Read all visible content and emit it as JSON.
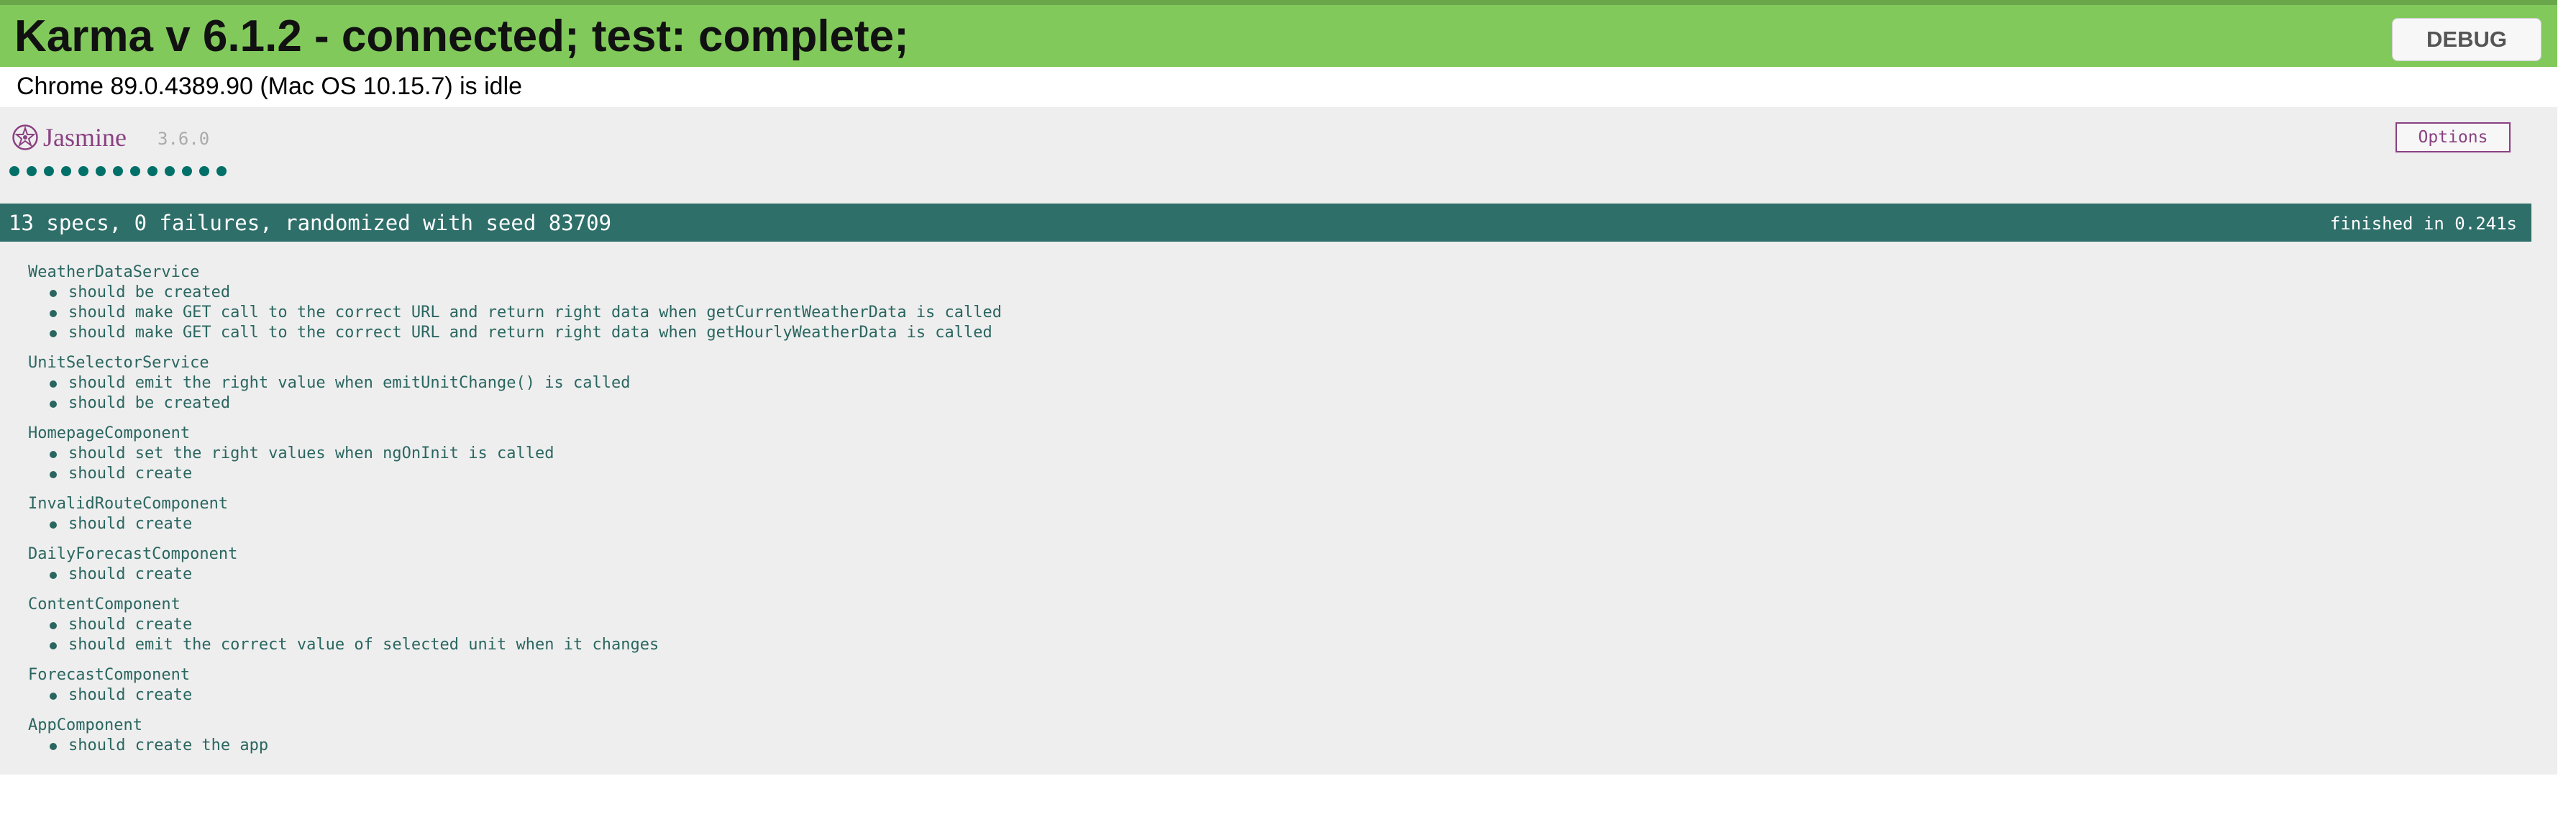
{
  "karma": {
    "title": "Karma v 6.1.2 - connected; test: complete;",
    "debug_label": "DEBUG",
    "browser_status": "Chrome 89.0.4389.90 (Mac OS 10.15.7) is idle",
    "banner_color": "#81c95b"
  },
  "jasmine": {
    "logo_text": "Jasmine",
    "version": "3.6.0",
    "options_label": "Options",
    "passed_dot_count": 13,
    "summary": "13 specs, 0 failures, randomized with seed 83709",
    "duration": "finished in 0.241s",
    "summary_color": "#2f6f6a",
    "pass_color": "#007069",
    "suites": [
      {
        "name": "WeatherDataService",
        "specs": [
          "should be created",
          "should make GET call to the correct URL and return right data when getCurrentWeatherData is called",
          "should make GET call to the correct URL and return right data when getHourlyWeatherData is called"
        ]
      },
      {
        "name": "UnitSelectorService",
        "specs": [
          "should emit the right value when emitUnitChange() is called",
          "should be created"
        ]
      },
      {
        "name": "HomepageComponent",
        "specs": [
          "should set the right values when ngOnInit is called",
          "should create"
        ]
      },
      {
        "name": "InvalidRouteComponent",
        "specs": [
          "should create"
        ]
      },
      {
        "name": "DailyForecastComponent",
        "specs": [
          "should create"
        ]
      },
      {
        "name": "ContentComponent",
        "specs": [
          "should create",
          "should emit the correct value of selected unit when it changes"
        ]
      },
      {
        "name": "ForecastComponent",
        "specs": [
          "should create"
        ]
      },
      {
        "name": "AppComponent",
        "specs": [
          "should create the app"
        ]
      }
    ]
  }
}
